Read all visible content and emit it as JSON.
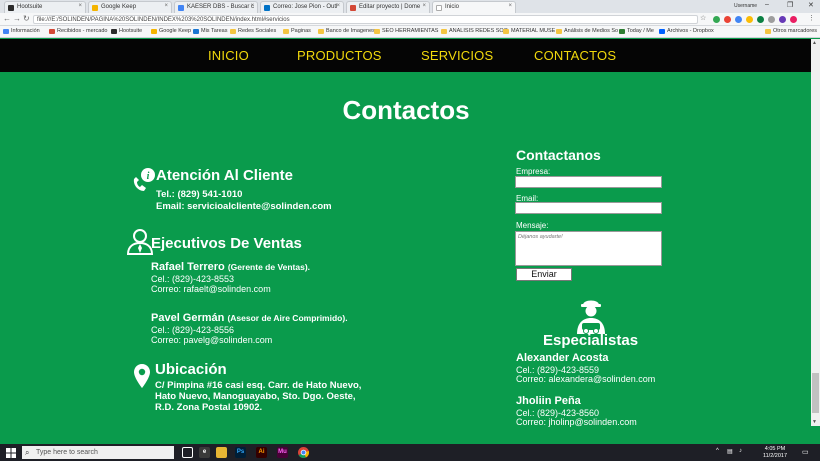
{
  "browser": {
    "tabs": [
      {
        "label": "Hootsuite",
        "color": "#2b2b2b"
      },
      {
        "label": "Google Keep",
        "color": "#f4b400"
      },
      {
        "label": "KAESER DBS - Buscar c",
        "color": "#4285f4"
      },
      {
        "label": "Correo: Jose Pion - Outl",
        "color": "#0072c6"
      },
      {
        "label": "Editar proyecto | Dome",
        "color": "#d34836"
      },
      {
        "label": "Inicio",
        "color": "#ffffff"
      }
    ],
    "user": "Username",
    "url": "file:///E:/SOLINDEN/PAGINA%20SOLINDEN/INDEX%203%20SOLINDEN/index.html#servicios",
    "bookmarks": [
      {
        "label": "Información",
        "color": "#4285f4"
      },
      {
        "label": "Recibidos - mercado",
        "color": "#d34836"
      },
      {
        "label": "Hootsuite",
        "color": "#2b2b2b"
      },
      {
        "label": "Google Keep",
        "color": "#f4b400"
      },
      {
        "label": "Mis Tareas",
        "color": "#1976d2"
      },
      {
        "label": "Redes Sociales",
        "color": "#f4c542"
      },
      {
        "label": "Paginas",
        "color": "#f4c542"
      },
      {
        "label": "Banco de Imagenes",
        "color": "#f4c542"
      },
      {
        "label": "SEO HERRAMIENTAS",
        "color": "#f4c542"
      },
      {
        "label": "ANALISIS REDES SOC",
        "color": "#f4c542"
      },
      {
        "label": "MATERIAL MUSE",
        "color": "#f4c542"
      },
      {
        "label": "Análisis de Medios So",
        "color": "#f4c542"
      },
      {
        "label": "Today / Me",
        "color": "#2e7d32"
      },
      {
        "label": "Archivos - Dropbox",
        "color": "#0061fe"
      },
      {
        "label": "Otros marcadores",
        "color": "#f4c542"
      }
    ]
  },
  "nav": {
    "items": [
      "INICIO",
      "PRODUCTOS",
      "SERVICIOS",
      "CONTACTOS"
    ]
  },
  "page": {
    "title": "Contactos"
  },
  "attention": {
    "title": "Atención Al Cliente",
    "phone": "Tel.: (829) 541-1010",
    "email": "Email: servicioalcliente@solinden.com"
  },
  "sales": {
    "title": "Ejecutivos De Ventas",
    "people": [
      {
        "name": "Rafael Terrero",
        "role": "(Gerente de Ventas).",
        "phone": "Cel.: (829)-423-8553",
        "email": "Correo: rafaelt@solinden.com"
      },
      {
        "name": "Pavel Germán",
        "role": "(Asesor de Aire Comprimido).",
        "phone": "Cel.: (829)-423-8556",
        "email": "Correo: pavelg@solinden.com"
      }
    ]
  },
  "location": {
    "title": "Ubicación",
    "lines": [
      "C/ Pimpina #16 casi esq. Carr. de Hato Nuevo,",
      "Hato Nuevo, Manoguayabo, Sto. Dgo. Oeste,",
      "R.D. Zona Postal 10902."
    ]
  },
  "form": {
    "title": "Contactanos",
    "company_label": "Empresa:",
    "email_label": "Email:",
    "message_label": "Mensaje:",
    "message_placeholder": "Déjanos ayudarte!",
    "submit": "Enviar"
  },
  "specialists": {
    "title": "Especialistas",
    "people": [
      {
        "name": "Alexander Acosta",
        "phone": "Cel.: (829)-423-8559",
        "email": "Correo: alexandera@solinden.com"
      },
      {
        "name": "Jholiin Peña",
        "phone": "Cel.: (829)-423-8560",
        "email": "Correo: jholinp@solinden.com"
      }
    ]
  },
  "taskbar": {
    "search_placeholder": "Type here to search",
    "time": "4:05 PM",
    "date": "11/2/2017"
  },
  "colors": {
    "page_bg": "#0a9b4c",
    "nav_bg": "#050505",
    "nav_text": "#f2d90c"
  }
}
